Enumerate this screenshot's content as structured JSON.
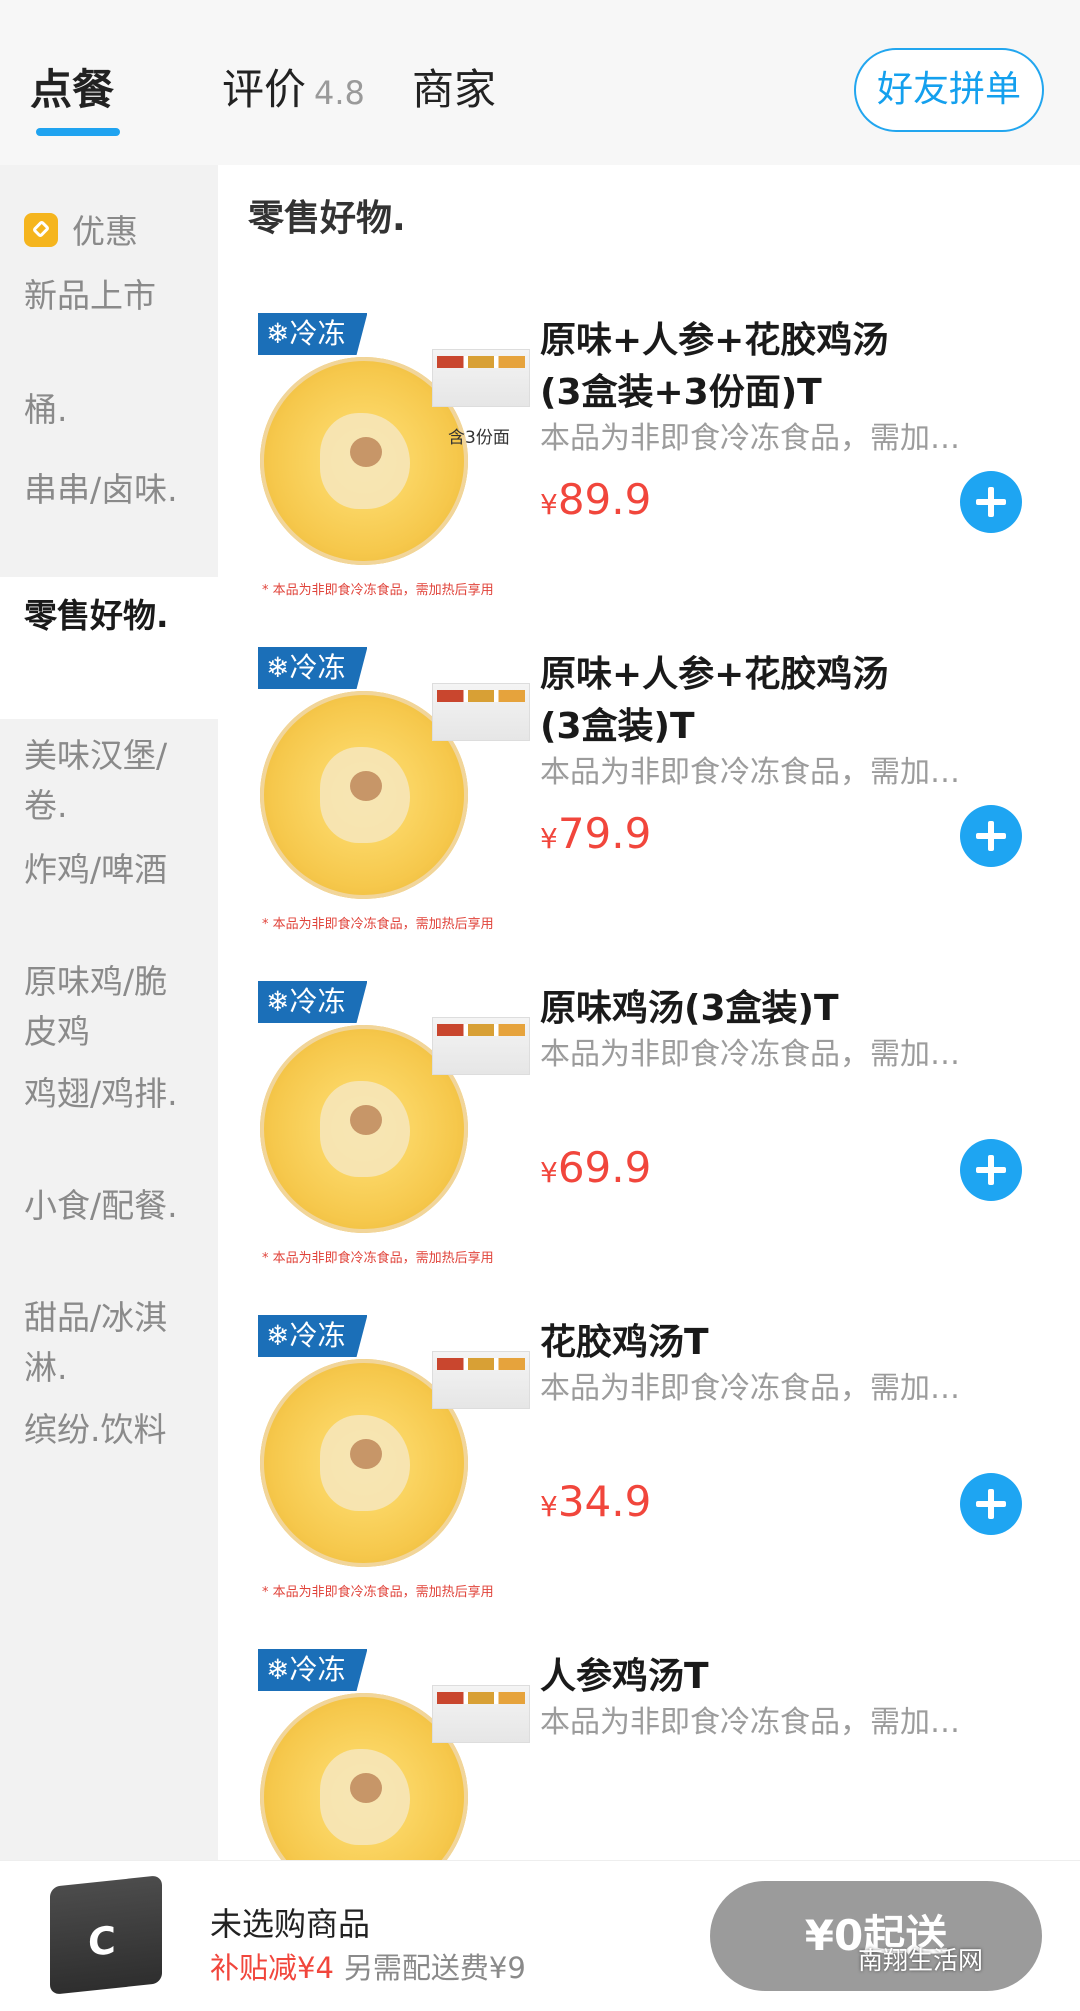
{
  "tabs": {
    "order": "点餐",
    "reviews": "评价",
    "reviews_rating": "4.8",
    "merchant": "商家",
    "group_order": "好友拼单"
  },
  "sidebar": {
    "items": [
      {
        "label": "优惠"
      },
      {
        "label": "新品上市"
      },
      {
        "label": "桶."
      },
      {
        "label": "串串/卤味."
      },
      {
        "label": "零售好物."
      },
      {
        "label": "美味汉堡/卷."
      },
      {
        "label": "炸鸡/啤酒"
      },
      {
        "label": "原味鸡/脆皮鸡"
      },
      {
        "label": "鸡翅/鸡排."
      },
      {
        "label": "小食/配餐."
      },
      {
        "label": "甜品/冰淇淋."
      },
      {
        "label": "缤纷.饮料"
      }
    ]
  },
  "section_title": "零售好物.",
  "products": [
    {
      "badge": "冷冻",
      "name": "原味+人参+花胶鸡汤(3盒装+3份面)T",
      "desc": "本品为非即食冷冻食品，需加…",
      "currency": "¥",
      "price": "89.9",
      "thumb_note": "* 本品为非即食冷冻食品，需加热后享用",
      "thumb_side": "含3份面"
    },
    {
      "badge": "冷冻",
      "name": "原味+人参+花胶鸡汤(3盒装)T",
      "desc": "本品为非即食冷冻食品，需加…",
      "currency": "¥",
      "price": "79.9",
      "thumb_note": "* 本品为非即食冷冻食品，需加热后享用",
      "thumb_side": ""
    },
    {
      "badge": "冷冻",
      "name": "原味鸡汤(3盒装)T",
      "desc": "本品为非即食冷冻食品，需加…",
      "currency": "¥",
      "price": "69.9",
      "thumb_note": "* 本品为非即食冷冻食品，需加热后享用",
      "thumb_side": ""
    },
    {
      "badge": "冷冻",
      "name": "花胶鸡汤T",
      "desc": "本品为非即食冷冻食品，需加…",
      "currency": "¥",
      "price": "34.9",
      "thumb_note": "* 本品为非即食冷冻食品，需加热后享用",
      "thumb_side": ""
    },
    {
      "badge": "冷冻",
      "name": "人参鸡汤T",
      "desc": "本品为非即食冷冻食品，需加…",
      "currency": "",
      "price": "",
      "thumb_note": "",
      "thumb_side": ""
    }
  ],
  "cart": {
    "status": "未选购商品",
    "subsidy": "补贴减¥4",
    "delivery_fee": "另需配送费¥9",
    "checkout": "¥0起送"
  },
  "watermark": "南翔生活网",
  "colors": {
    "accent": "#1fa3f0",
    "price": "#f1463c",
    "freeze_badge": "#1b6fb8"
  },
  "icons": {
    "promo": "tag-icon",
    "add": "plus-circle-icon",
    "cart": "cart-box-icon",
    "freeze": "snowflake-icon"
  }
}
